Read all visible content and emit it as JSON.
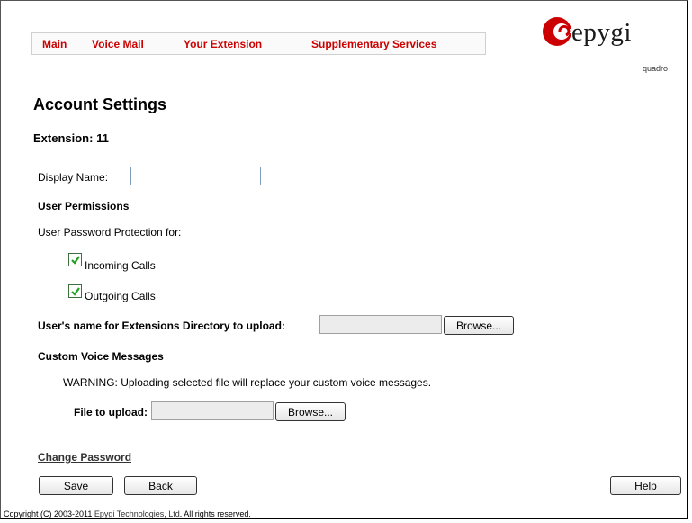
{
  "nav": {
    "items": [
      "Main",
      "Voice Mail",
      "Your Extension",
      "Supplementary Services"
    ]
  },
  "logo": {
    "word": "epygi",
    "sub": "quadro",
    "brand_color": "#cc0000"
  },
  "page": {
    "title": "Account Settings",
    "extension_label": "Extension: 11"
  },
  "form": {
    "display_name_label": "Display Name:",
    "display_name_value": "",
    "user_permissions_heading": "User Permissions",
    "password_protection_label": "User Password Protection for:",
    "incoming_calls_label": "Incoming Calls",
    "incoming_calls_checked": true,
    "outgoing_calls_label": "Outgoing Calls",
    "outgoing_calls_checked": true,
    "directory_upload_label": "User's name for Extensions Directory to upload:",
    "browse_label": "Browse...",
    "custom_voice_heading": "Custom Voice Messages",
    "warning_text": "WARNING: Uploading selected file will replace your custom voice messages.",
    "file_upload_label": "File to upload:",
    "change_password_link": "Change Password"
  },
  "buttons": {
    "save": "Save",
    "back": "Back",
    "help": "Help"
  },
  "footer": {
    "prefix": "Copyright (C) 2003-2011 ",
    "company_link": "Epygi Technologies, Ltd",
    "suffix": ". All rights reserved."
  }
}
